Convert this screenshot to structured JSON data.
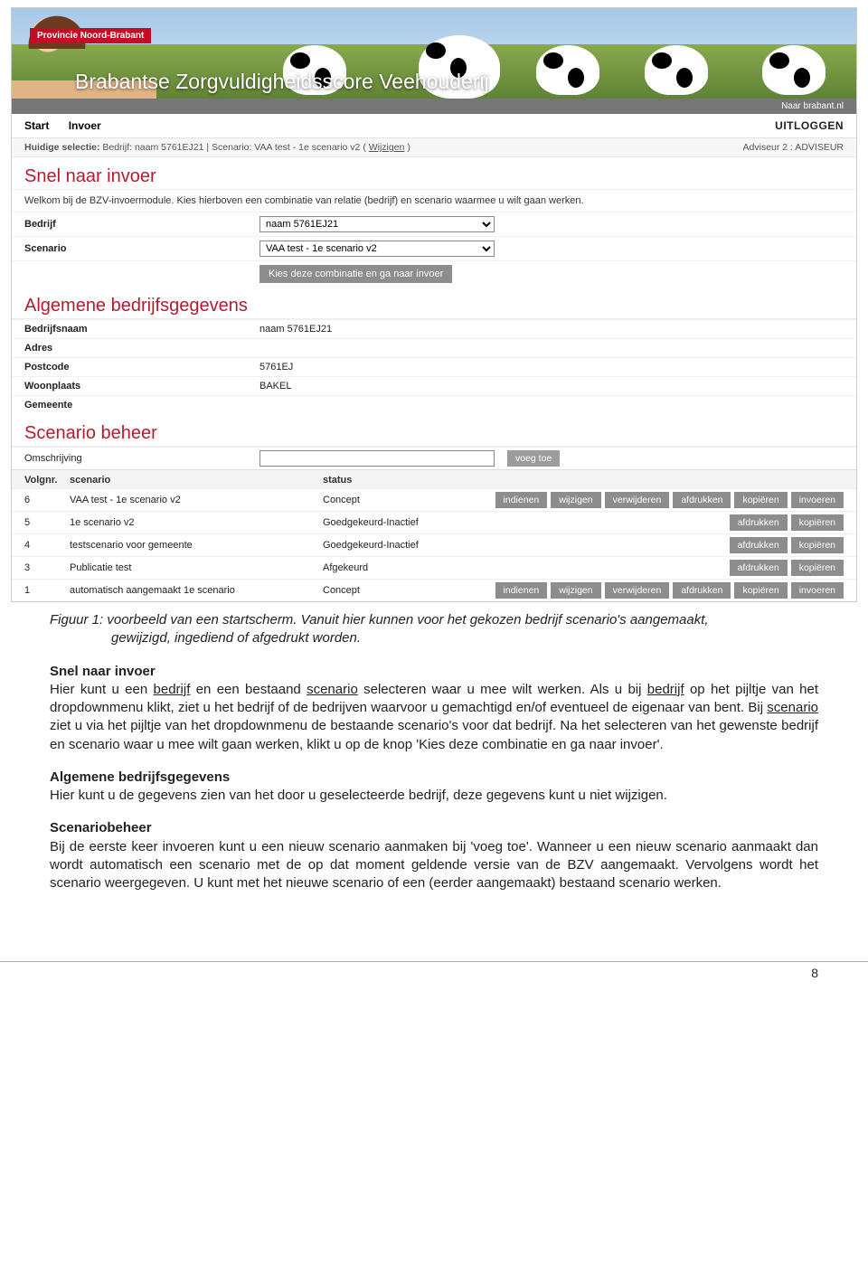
{
  "banner": {
    "province_tag": "Provincie Noord-Brabant",
    "title": "Brabantse Zorgvuldigheidsscore Veehouderij",
    "top_link": "Naar brabant.nl"
  },
  "nav": {
    "start": "Start",
    "invoer": "Invoer",
    "logout": "UITLOGGEN"
  },
  "selection": {
    "left_label": "Huidige selectie:",
    "left_value": "Bedrijf: naam 5761EJ21  |  Scenario: VAA test - 1e scenario v2  (",
    "wijzigen": "Wijzigen",
    "left_tail": " )",
    "right": "Adviseur 2   : ADVISEUR"
  },
  "snel": {
    "heading": "Snel naar invoer",
    "intro": "Welkom bij de BZV-invoermodule. Kies hierboven een combinatie van relatie (bedrijf) en scenario waarmee u wilt gaan werken.",
    "bedrijf_label": "Bedrijf",
    "bedrijf_value": "naam 5761EJ21",
    "scenario_label": "Scenario",
    "scenario_value": "VAA test - 1e scenario v2",
    "go_button": "Kies deze combinatie en ga naar invoer"
  },
  "bedrijf": {
    "heading": "Algemene bedrijfsgegevens",
    "rows": [
      {
        "lab": "Bedrijfsnaam",
        "val": "naam 5761EJ21"
      },
      {
        "lab": "Adres",
        "val": ""
      },
      {
        "lab": "Postcode",
        "val": "5761EJ"
      },
      {
        "lab": "Woonplaats",
        "val": "BAKEL"
      },
      {
        "lab": "Gemeente",
        "val": ""
      }
    ]
  },
  "scenario": {
    "heading": "Scenario beheer",
    "desc_label": "Omschrijving",
    "voegtoe": "voeg toe",
    "head": {
      "nr": "Volgnr.",
      "sc": "scenario",
      "st": "status"
    },
    "rows": [
      {
        "nr": "6",
        "sc": "VAA test - 1e scenario v2",
        "st": "Concept",
        "actions": [
          "indienen",
          "wijzigen",
          "verwijderen",
          "afdrukken",
          "kopiëren",
          "invoeren"
        ]
      },
      {
        "nr": "5",
        "sc": "1e scenario v2",
        "st": "Goedgekeurd-Inactief",
        "actions": [
          "afdrukken",
          "kopiëren"
        ]
      },
      {
        "nr": "4",
        "sc": "testscenario voor gemeente",
        "st": "Goedgekeurd-Inactief",
        "actions": [
          "afdrukken",
          "kopiëren"
        ]
      },
      {
        "nr": "3",
        "sc": "Publicatie test",
        "st": "Afgekeurd",
        "actions": [
          "afdrukken",
          "kopiëren"
        ]
      },
      {
        "nr": "1",
        "sc": "automatisch aangemaakt 1e scenario",
        "st": "Concept",
        "actions": [
          "indienen",
          "wijzigen",
          "verwijderen",
          "afdrukken",
          "kopiëren",
          "invoeren"
        ]
      }
    ]
  },
  "doc": {
    "caption1": "Figuur 1: voorbeeld van een startscherm. Vanuit hier kunnen voor het gekozen bedrijf scenario's aangemaakt,",
    "caption2": "gewijzigd, ingediend of afgedrukt worden.",
    "h1": "Snel naar invoer",
    "p1a": "Hier kunt u een ",
    "p1b": " en een bestaand ",
    "p1c": " selecteren waar u mee wilt werken. Als u bij ",
    "p1d": " op het pijltje van het dropdownmenu klikt, ziet u het bedrijf of de bedrijven waarvoor u gemachtigd en/of eventueel de eigenaar van bent. Bij ",
    "p1e": " ziet u via het pijltje van het dropdownmenu de bestaande scenario's voor dat bedrijf. Na het selecteren van het gewenste bedrijf en scenario waar u mee wilt gaan werken, klikt u op de knop 'Kies deze combinatie en ga naar invoer'.",
    "u_bedrijf": "bedrijf",
    "u_scenario": "scenario",
    "h2": "Algemene bedrijfsgegevens",
    "p2": "Hier kunt u de gegevens zien van het door u geselecteerde bedrijf, deze gegevens kunt u niet wijzigen.",
    "h3": "Scenariobeheer",
    "p3": "Bij de eerste keer invoeren kunt u een nieuw scenario aanmaken bij 'voeg toe'. Wanneer u een nieuw scenario aanmaakt dan wordt automatisch een scenario met de op dat moment geldende versie van de BZV aangemaakt. Vervolgens wordt het scenario weergegeven. U kunt met het nieuwe scenario of een (eerder aangemaakt) bestaand scenario werken.",
    "page": "8"
  }
}
